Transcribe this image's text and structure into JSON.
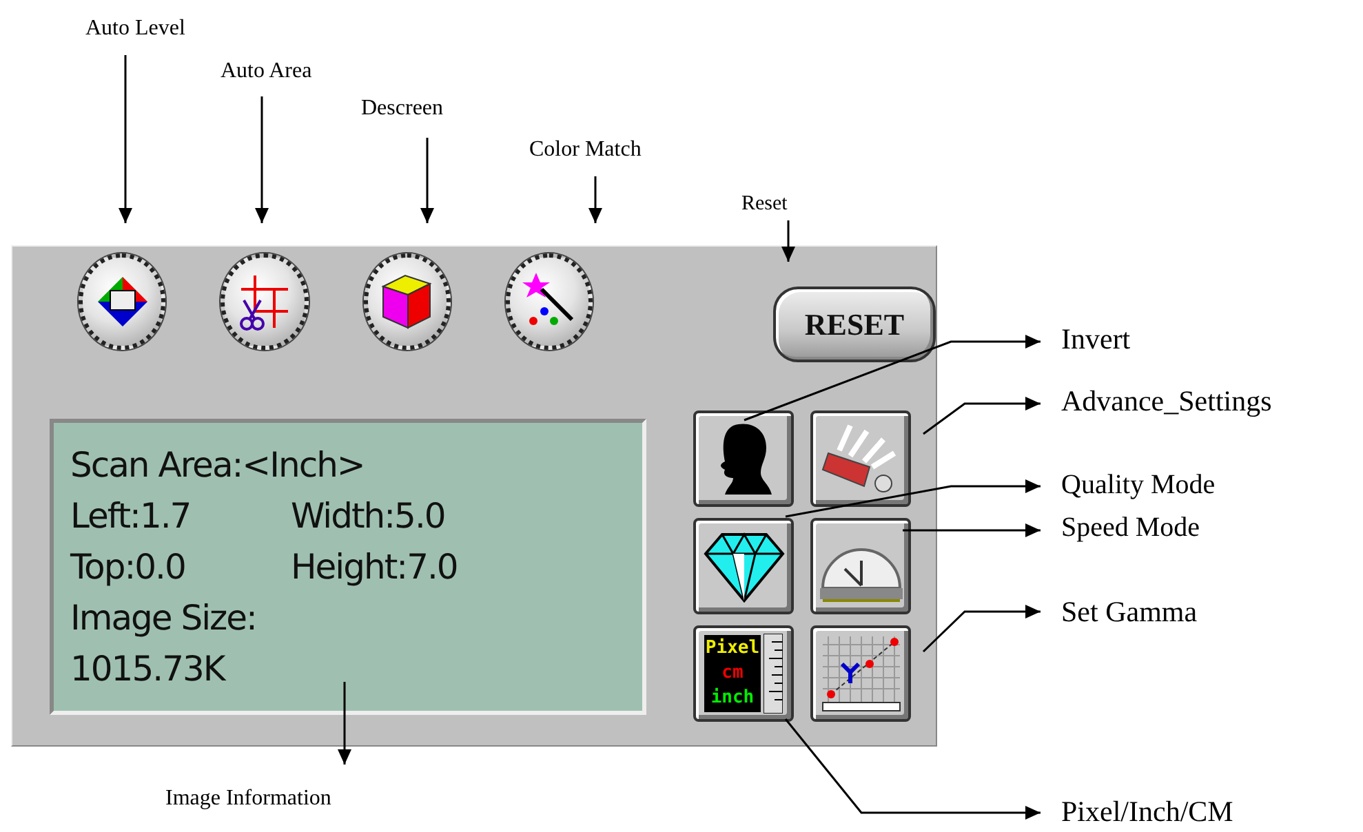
{
  "panel": {
    "round_buttons": [
      {
        "kind": "level"
      },
      {
        "kind": "area"
      },
      {
        "kind": "descreen"
      },
      {
        "kind": "match"
      }
    ],
    "reset": {
      "label": "RESET"
    },
    "info": {
      "title": "Scan Area:<Inch>",
      "rows": [
        [
          "Left:1.7",
          "Width:5.0"
        ],
        [
          "Top:0.0",
          "Height:7.0"
        ]
      ],
      "size_label": "Image Size:",
      "size_value": "1015.73K"
    },
    "square_buttons": [
      {
        "kind": "invert"
      },
      {
        "kind": "advance"
      },
      {
        "kind": "quality"
      },
      {
        "kind": "speed"
      },
      {
        "kind": "units",
        "labels": [
          "Pixel",
          "cm",
          "inch"
        ]
      },
      {
        "kind": "gamma"
      }
    ]
  },
  "callouts": [
    "Auto Level",
    "Auto Area",
    "Descreen",
    "Color Match",
    "Reset",
    "Invert",
    "Advance_Settings",
    "Quality Mode",
    "Speed Mode",
    "Set Gamma",
    "Pixel/Inch/CM",
    "Image Information"
  ]
}
